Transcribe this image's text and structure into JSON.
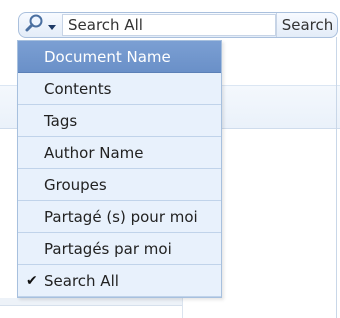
{
  "search": {
    "value": "Search All",
    "button_label": "Search",
    "scope_icon": "magnifier-icon"
  },
  "menu": {
    "items": [
      {
        "label": "Document Name",
        "selected": true,
        "checked": false
      },
      {
        "label": "Contents",
        "selected": false,
        "checked": false
      },
      {
        "label": "Tags",
        "selected": false,
        "checked": false
      },
      {
        "label": "Author Name",
        "selected": false,
        "checked": false
      },
      {
        "label": "Groupes",
        "selected": false,
        "checked": false
      },
      {
        "label": "Partagé (s) pour moi",
        "selected": false,
        "checked": false
      },
      {
        "label": "Partagés par moi",
        "selected": false,
        "checked": false
      },
      {
        "label": "Search All",
        "selected": false,
        "checked": true
      }
    ],
    "check_glyph": "✔"
  },
  "colors": {
    "highlight": "#6d92ca",
    "menu_bg": "#e8f1fc",
    "border": "#a7c0de"
  }
}
